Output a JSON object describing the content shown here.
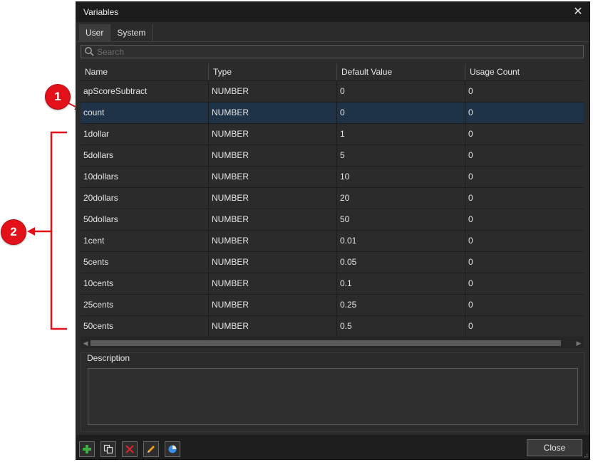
{
  "window": {
    "title": "Variables"
  },
  "tabs": [
    {
      "label": "User",
      "active": true
    },
    {
      "label": "System",
      "active": false
    }
  ],
  "search": {
    "placeholder": "Search",
    "value": ""
  },
  "table": {
    "columns": [
      "Name",
      "Type",
      "Default Value",
      "Usage Count"
    ],
    "rows": [
      [
        "apScoreSubtract",
        "NUMBER",
        "0",
        "0"
      ],
      [
        "count",
        "NUMBER",
        "0",
        "0"
      ],
      [
        "1dollar",
        "NUMBER",
        "1",
        "0"
      ],
      [
        "5dollars",
        "NUMBER",
        "5",
        "0"
      ],
      [
        "10dollars",
        "NUMBER",
        "10",
        "0"
      ],
      [
        "20dollars",
        "NUMBER",
        "20",
        "0"
      ],
      [
        "50dollars",
        "NUMBER",
        "50",
        "0"
      ],
      [
        "1cent",
        "NUMBER",
        "0.01",
        "0"
      ],
      [
        "5cents",
        "NUMBER",
        "0.05",
        "0"
      ],
      [
        "10cents",
        "NUMBER",
        "0.1",
        "0"
      ],
      [
        "25cents",
        "NUMBER",
        "0.25",
        "0"
      ],
      [
        "50cents",
        "NUMBER",
        "0.5",
        "0"
      ]
    ],
    "selected_row": "count"
  },
  "description": {
    "label": "Description",
    "value": ""
  },
  "toolbar": {
    "buttons": [
      "add-icon",
      "duplicate-icon",
      "delete-icon",
      "edit-icon",
      "usage-chart-icon"
    ],
    "close_label": "Close"
  },
  "annotations": {
    "badge_1": "1",
    "badge_2": "2",
    "color": "#e3121a"
  },
  "colors": {
    "window_bg": "#2b2b2b",
    "title_bg": "#1c1c1c",
    "selected_row": "#1e3347",
    "add_green": "#3cb043",
    "delete_red": "#d9262c",
    "edit_orange": "#f0a020",
    "chart_blue": "#3a8ee6"
  }
}
